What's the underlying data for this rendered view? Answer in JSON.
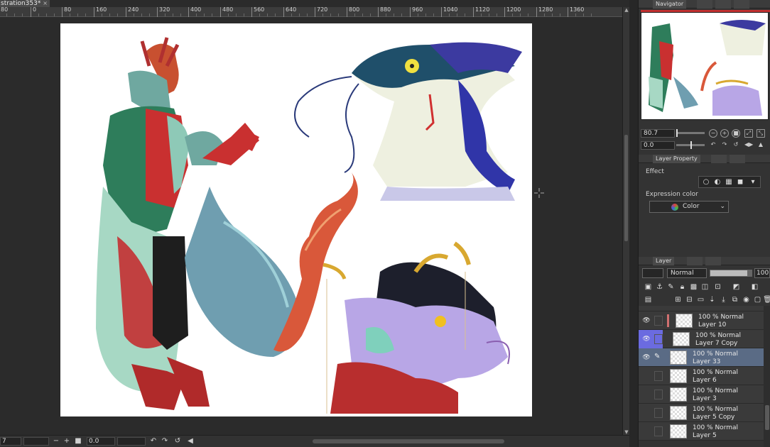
{
  "document": {
    "tab_title": "stration353*",
    "close_label": "×"
  },
  "ruler": {
    "ticks": [
      "80",
      "0",
      "80",
      "160",
      "240",
      "320",
      "400",
      "480",
      "560",
      "640",
      "720",
      "800",
      "880",
      "960",
      "1040",
      "1120",
      "1200",
      "1280",
      "1360"
    ]
  },
  "statusbar": {
    "zoom": "7",
    "rotation": "0.0",
    "minus": "−",
    "plus": "+"
  },
  "panel": {
    "navigator_tab": "Navigator",
    "navigator_zoom": "80.7",
    "navigator_rotation": "0.0",
    "layer_property_tab": "Layer Property",
    "effect_label": "Effect",
    "expression_color_label": "Expression color",
    "expression_color_value": "Color",
    "layer_tab": "Layer",
    "blend_mode": "Normal",
    "opacity": "100"
  },
  "layers": [
    {
      "opacity": "100 %",
      "blend": "Normal",
      "name": "Layer 10",
      "visible": true,
      "clipped": true,
      "selected": false
    },
    {
      "opacity": "100 %",
      "blend": "Normal",
      "name": "Layer 7 Copy",
      "visible": true,
      "clipped": false,
      "selected": false,
      "highlight": true
    },
    {
      "opacity": "100 %",
      "blend": "Normal",
      "name": "Layer 33",
      "visible": true,
      "clipped": false,
      "selected": true
    },
    {
      "opacity": "100 %",
      "blend": "Normal",
      "name": "Layer 6",
      "visible": false,
      "clipped": false,
      "selected": false
    },
    {
      "opacity": "100 %",
      "blend": "Normal",
      "name": "Layer 3",
      "visible": false,
      "clipped": false,
      "selected": false
    },
    {
      "opacity": "100 %",
      "blend": "Normal",
      "name": "Layer 5 Copy",
      "visible": false,
      "clipped": false,
      "selected": false
    },
    {
      "opacity": "100 %",
      "blend": "Normal",
      "name": "Layer 5",
      "visible": false,
      "clipped": false,
      "selected": false
    }
  ],
  "colors": {
    "selected_layer": "#5a6b85",
    "accent_red": "#c03030",
    "highlight_blue": "#6b6be0"
  }
}
